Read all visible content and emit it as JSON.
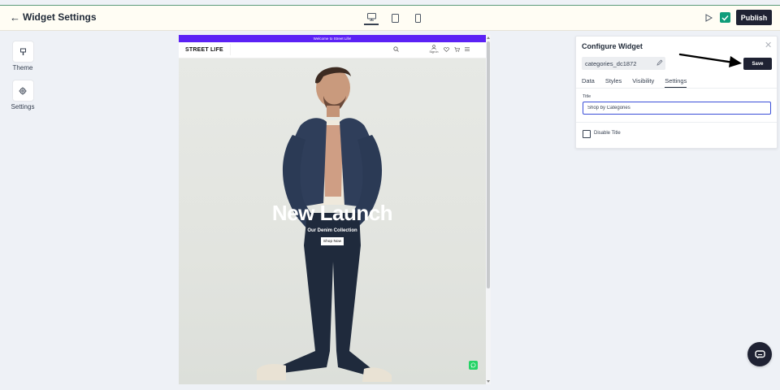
{
  "header": {
    "back_icon": "←",
    "title": "Widget Settings",
    "publish_label": "Publish"
  },
  "rail": {
    "items": [
      {
        "label": "Theme",
        "icon": "brush-icon"
      },
      {
        "label": "Settings",
        "icon": "gear-icon"
      }
    ]
  },
  "site": {
    "announcement": "Welcome to Street Life!",
    "logo": "STREET LIFE",
    "signin_label": "Sign In",
    "hero": {
      "title": "New Launch",
      "subtitle": "Our Denim Collection",
      "button_label": "Shop Now"
    }
  },
  "panel": {
    "title": "Configure Widget",
    "close_icon": "✕",
    "widget_id": "categories_dc1872",
    "save_label": "Save",
    "tabs": [
      {
        "label": "Data"
      },
      {
        "label": "Styles"
      },
      {
        "label": "Visibility"
      },
      {
        "label": "Settings"
      }
    ],
    "active_tab": "Settings",
    "title_field_label": "Title",
    "title_field_value": "Shop by Categories",
    "disable_title_label": "Disable Title",
    "disable_title_checked": false
  },
  "colors": {
    "accent": "#1f2233",
    "announcement": "#5b21f5",
    "check": "#0f9d7a",
    "whatsapp": "#25d366",
    "input_focus": "#3b4fd8"
  }
}
